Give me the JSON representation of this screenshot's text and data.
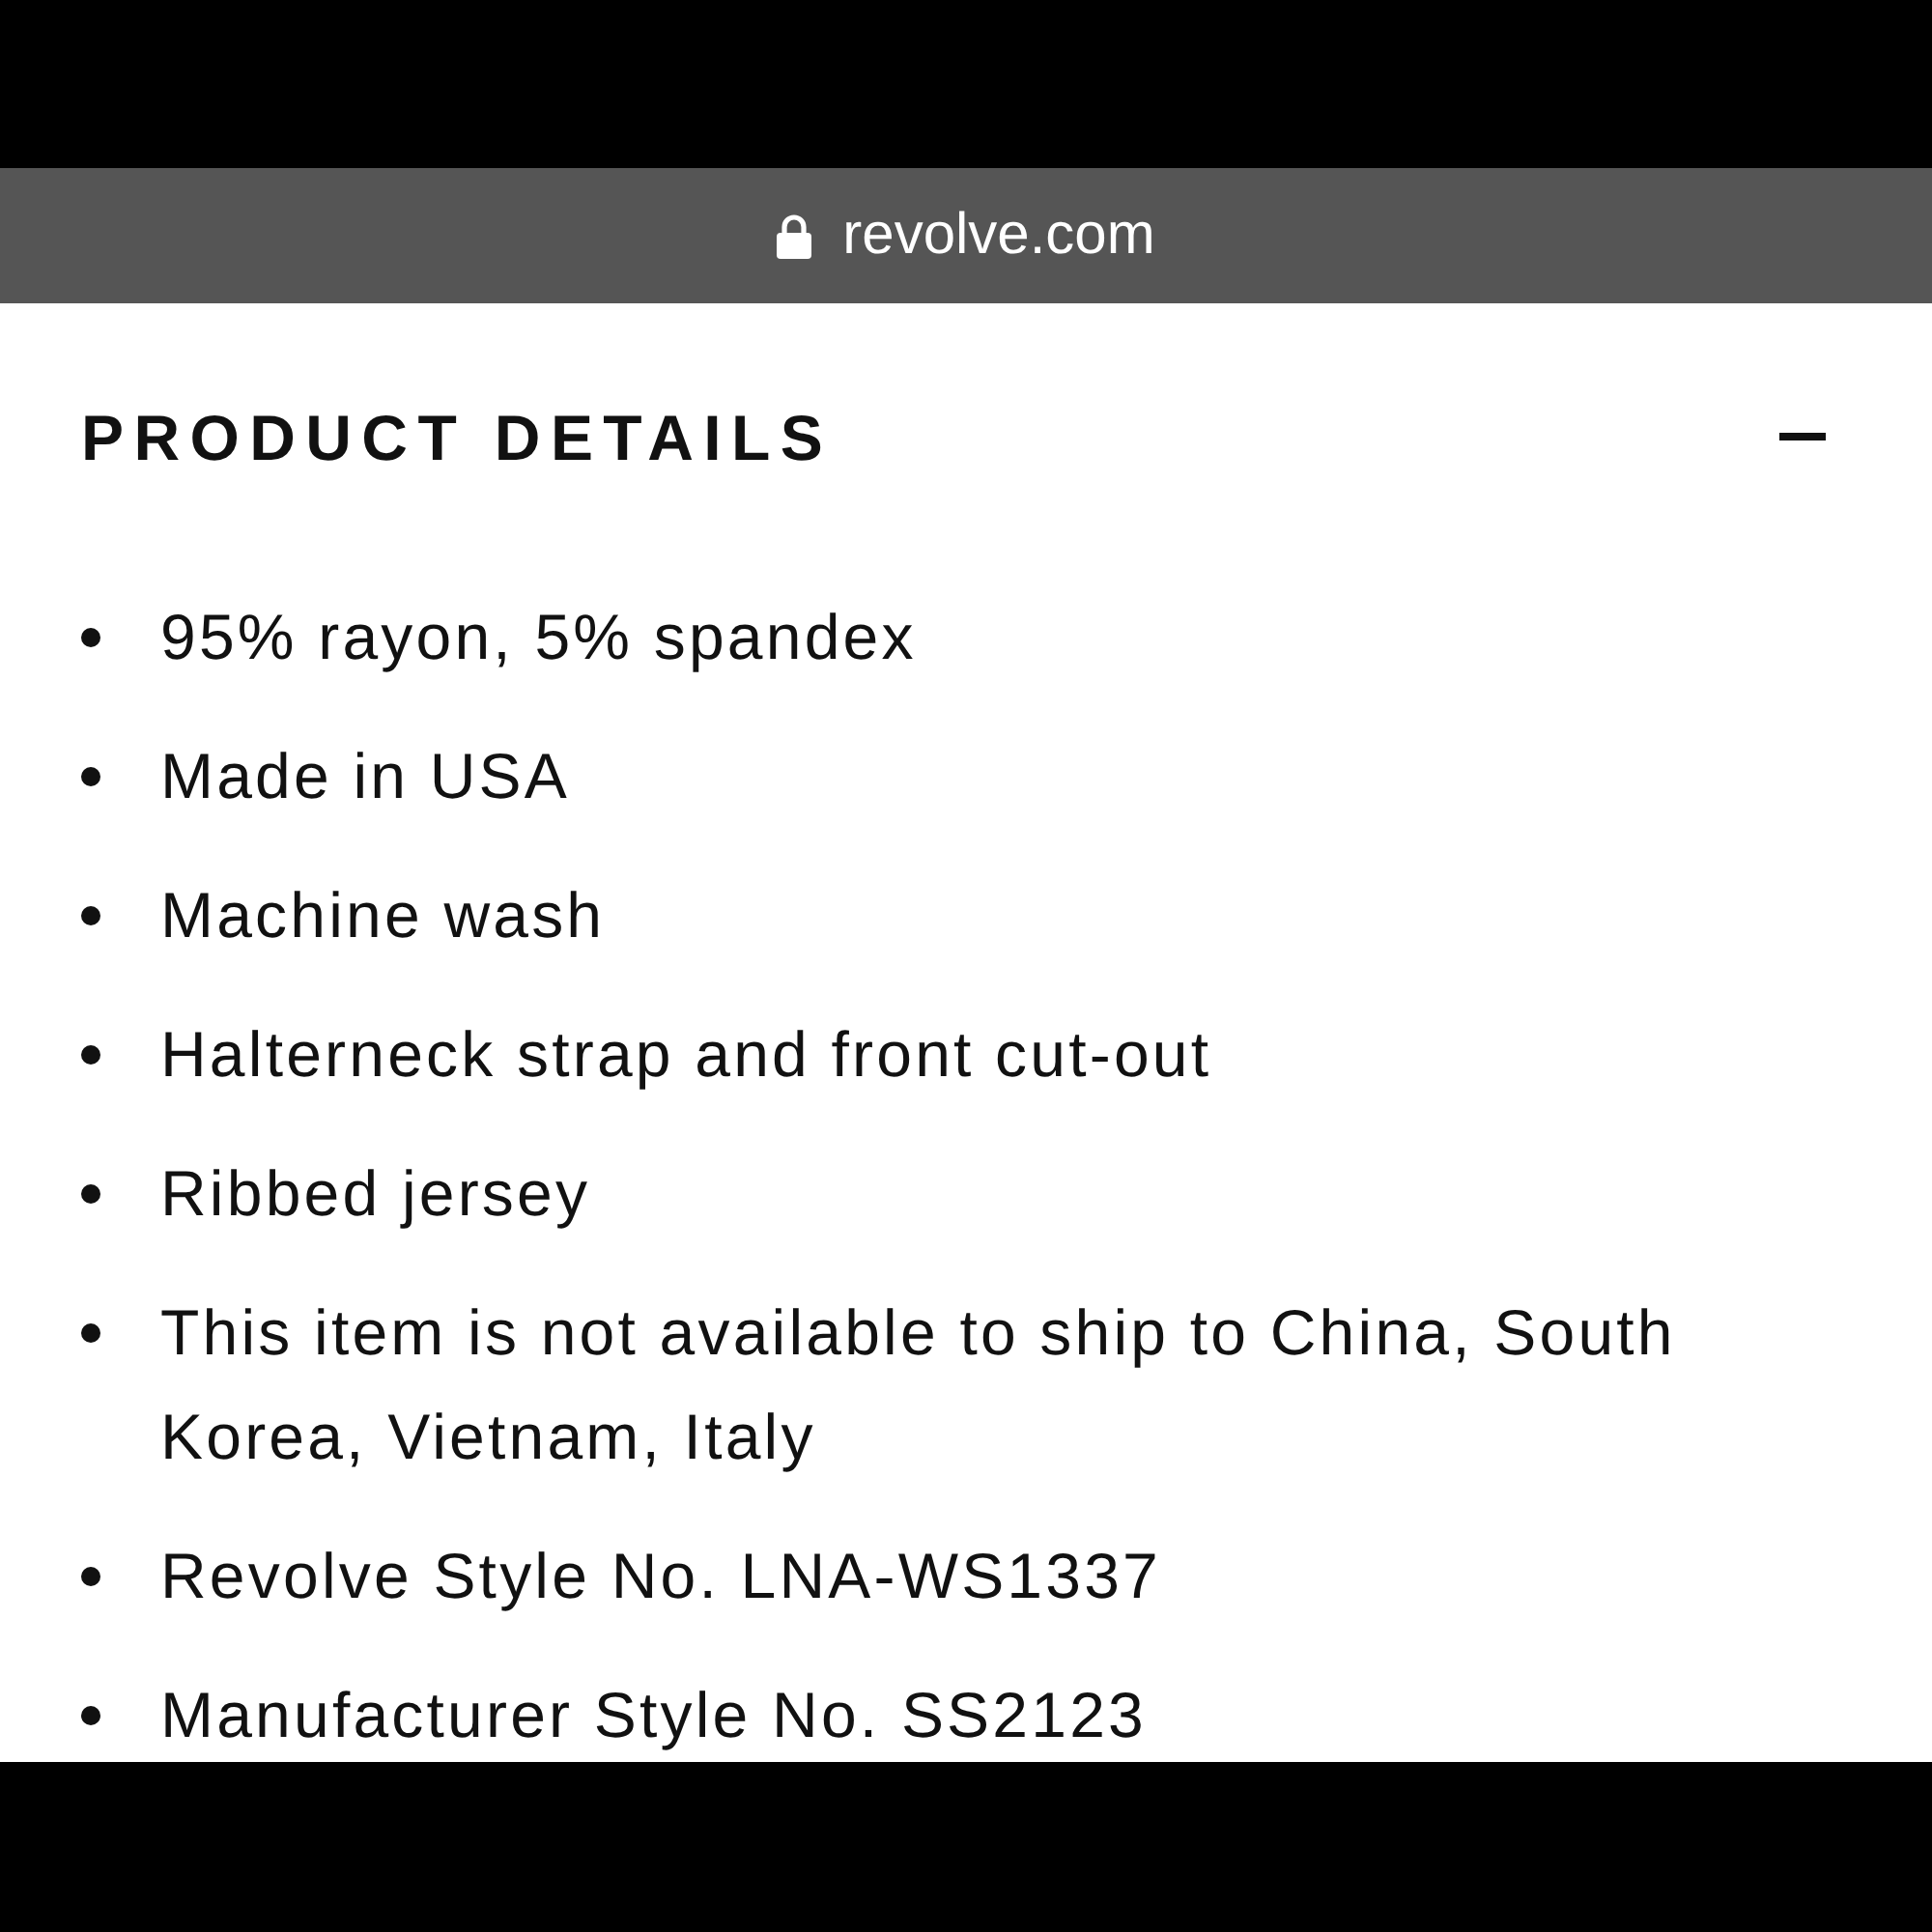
{
  "address_bar": {
    "url": "revolve.com",
    "secure": true
  },
  "section": {
    "title": "PRODUCT DETAILS",
    "expanded": true
  },
  "details": [
    "95% rayon, 5% spandex",
    "Made in USA",
    "Machine wash",
    "Halterneck strap and front cut-out",
    "Ribbed jersey",
    "This item is not available to ship to China, South Korea, Vietnam, Italy",
    "Revolve Style No. LNA-WS1337",
    "Manufacturer Style No. SS2123"
  ]
}
